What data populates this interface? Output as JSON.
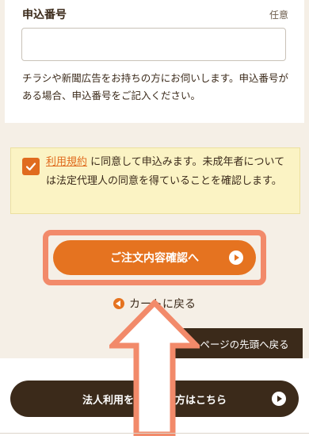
{
  "application_number": {
    "label": "申込番号",
    "optional_tag": "任意",
    "input_value": "",
    "input_placeholder": "",
    "help_text": "チラシや新聞広告をお持ちの方にお伺いします。申込番号がある場合、申込番号をご記入ください。"
  },
  "agreement": {
    "checked": true,
    "terms_link": "利用規約",
    "text": "に同意して申込みます。未成年者については法定代理人の同意を得ていることを確認します。"
  },
  "actions": {
    "confirm_label": "ご注文内容確認へ",
    "back_label": "カートに戻る",
    "page_top_label": "ページの先頭へ戻る",
    "corporate_label": "法人利用をご検討の方はこちら"
  },
  "colors": {
    "accent_orange": "#e57320",
    "highlight": "#f28a6a",
    "dark_brown": "#3b2a1a",
    "notice_yellow": "#fbf3c4"
  }
}
